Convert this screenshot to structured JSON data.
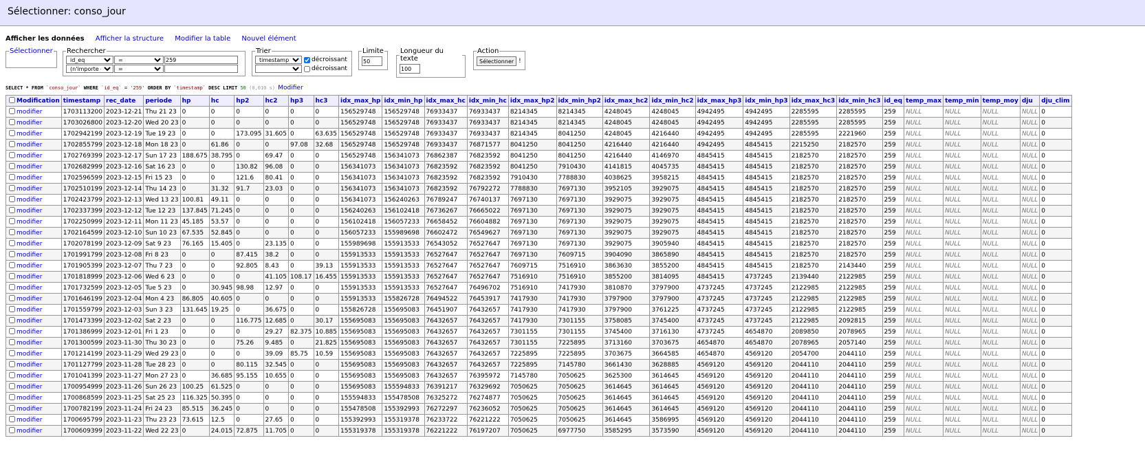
{
  "title": "Sélectionner: conso_jour",
  "nav": [
    "Afficher les données",
    "Afficher la structure",
    "Modifier la table",
    "Nouvel élément"
  ],
  "forms": {
    "select_legend": "Sélectionner",
    "search_legend": "Rechercher",
    "search_rows": [
      {
        "column": "id_eq",
        "op": "=",
        "value": "259"
      },
      {
        "column": "(n'importe où)",
        "op": "=",
        "value": ""
      }
    ],
    "sort_legend": "Trier",
    "sort_rows": [
      {
        "column": "timestamp",
        "desc_checked": true,
        "label": "décroissant"
      },
      {
        "column": "",
        "desc_checked": false,
        "label": "décroissant"
      }
    ],
    "limit_legend": "Limite",
    "limit_value": "50",
    "textlen_legend": "Longueur du texte",
    "textlen_value": "100",
    "action_legend": "Action",
    "action_button": "Sélectionner",
    "action_suffix": "!"
  },
  "sql": {
    "parts": [
      "SELECT * FROM ",
      "`conso_jour`",
      " WHERE ",
      "`id_eq`",
      " = ",
      "'259'",
      " ORDER BY ",
      "`timestamp`",
      " DESC LIMIT ",
      "50",
      " (0,010 s) "
    ],
    "link": "Modifier"
  },
  "table": {
    "modification_label": "Modification",
    "row_link": "modifier",
    "columns": [
      "timestamp",
      "rec_date",
      "periode",
      "hp",
      "hc",
      "hp2",
      "hc2",
      "hp3",
      "hc3",
      "idx_max_hp",
      "idx_min_hp",
      "idx_max_hc",
      "idx_min_hc",
      "idx_max_hp2",
      "idx_min_hp2",
      "idx_max_hc2",
      "idx_min_hc2",
      "idx_max_hp3",
      "idx_min_hp3",
      "idx_max_hc3",
      "idx_min_hc3",
      "id_eq",
      "temp_max",
      "temp_min",
      "temp_moy",
      "dju",
      "dju_clim"
    ],
    "rows": [
      [
        "1703113200",
        "2023-12-21",
        "Thu 21 23",
        "0",
        "0",
        "0",
        "0",
        "0",
        "0",
        "156529748",
        "156529748",
        "76933437",
        "76933437",
        "8214345",
        "8214345",
        "4248045",
        "4248045",
        "4942495",
        "4942495",
        "2285595",
        "2285595",
        "259",
        "NULL",
        "NULL",
        "NULL",
        "NULL",
        "0"
      ],
      [
        "1703026800",
        "2023-12-20",
        "Wed 20 23",
        "0",
        "0",
        "0",
        "0",
        "0",
        "0",
        "156529748",
        "156529748",
        "76933437",
        "76933437",
        "8214345",
        "8214345",
        "4248045",
        "4248045",
        "4942495",
        "4942495",
        "2285595",
        "2285595",
        "259",
        "NULL",
        "NULL",
        "NULL",
        "NULL",
        "0"
      ],
      [
        "1702942199",
        "2023-12-19",
        "Tue 19 23",
        "0",
        "0",
        "173.095",
        "31.605",
        "0",
        "63.635",
        "156529748",
        "156529748",
        "76933437",
        "76933437",
        "8214345",
        "8041250",
        "4248045",
        "4216440",
        "4942495",
        "4942495",
        "2285595",
        "2221960",
        "259",
        "NULL",
        "NULL",
        "NULL",
        "NULL",
        "0"
      ],
      [
        "1702855799",
        "2023-12-18",
        "Mon 18 23",
        "0",
        "61.86",
        "0",
        "0",
        "97.08",
        "32.68",
        "156529748",
        "156529748",
        "76933437",
        "76871577",
        "8041250",
        "8041250",
        "4216440",
        "4216440",
        "4942495",
        "4845415",
        "2215250",
        "2182570",
        "259",
        "NULL",
        "NULL",
        "NULL",
        "NULL",
        "0"
      ],
      [
        "1702769399",
        "2023-12-17",
        "Sun 17 23",
        "188.675",
        "38.795",
        "0",
        "69.47",
        "0",
        "0",
        "156529748",
        "156341073",
        "76862387",
        "76823592",
        "8041250",
        "8041250",
        "4216440",
        "4146970",
        "4845415",
        "4845415",
        "2182570",
        "2182570",
        "259",
        "NULL",
        "NULL",
        "NULL",
        "NULL",
        "0"
      ],
      [
        "1702682999",
        "2023-12-16",
        "Sat 16 23",
        "0",
        "0",
        "130.82",
        "96.08",
        "0",
        "0",
        "156341073",
        "156341073",
        "76823592",
        "76823592",
        "8041250",
        "7910430",
        "4141815",
        "4045735",
        "4845415",
        "4845415",
        "2182570",
        "2182570",
        "259",
        "NULL",
        "NULL",
        "NULL",
        "NULL",
        "0"
      ],
      [
        "1702596599",
        "2023-12-15",
        "Fri 15 23",
        "0",
        "0",
        "121.6",
        "80.41",
        "0",
        "0",
        "156341073",
        "156341073",
        "76823592",
        "76823592",
        "7910430",
        "7788830",
        "4038625",
        "3958215",
        "4845415",
        "4845415",
        "2182570",
        "2182570",
        "259",
        "NULL",
        "NULL",
        "NULL",
        "NULL",
        "0"
      ],
      [
        "1702510199",
        "2023-12-14",
        "Thu 14 23",
        "0",
        "31.32",
        "91.7",
        "23.03",
        "0",
        "0",
        "156341073",
        "156341073",
        "76823592",
        "76792272",
        "7788830",
        "7697130",
        "3952105",
        "3929075",
        "4845415",
        "4845415",
        "2182570",
        "2182570",
        "259",
        "NULL",
        "NULL",
        "NULL",
        "NULL",
        "0"
      ],
      [
        "1702423799",
        "2023-12-13",
        "Wed 13 23",
        "100.81",
        "49.11",
        "0",
        "0",
        "0",
        "0",
        "156341073",
        "156240263",
        "76789247",
        "76740137",
        "7697130",
        "7697130",
        "3929075",
        "3929075",
        "4845415",
        "4845415",
        "2182570",
        "2182570",
        "259",
        "NULL",
        "NULL",
        "NULL",
        "NULL",
        "0"
      ],
      [
        "1702337399",
        "2023-12-12",
        "Tue 12 23",
        "137.845",
        "71.245",
        "0",
        "0",
        "0",
        "0",
        "156240263",
        "156102418",
        "76736267",
        "76665022",
        "7697130",
        "7697130",
        "3929075",
        "3929075",
        "4845415",
        "4845415",
        "2182570",
        "2182570",
        "259",
        "NULL",
        "NULL",
        "NULL",
        "NULL",
        "0"
      ],
      [
        "1702250999",
        "2023-12-11",
        "Mon 11 23",
        "45.185",
        "53.57",
        "0",
        "0",
        "0",
        "0",
        "156102418",
        "156057233",
        "76658452",
        "76604882",
        "7697130",
        "7697130",
        "3929075",
        "3929075",
        "4845415",
        "4845415",
        "2182570",
        "2182570",
        "259",
        "NULL",
        "NULL",
        "NULL",
        "NULL",
        "0"
      ],
      [
        "1702164599",
        "2023-12-10",
        "Sun 10 23",
        "67.535",
        "52.845",
        "0",
        "0",
        "0",
        "0",
        "156057233",
        "155989698",
        "76602472",
        "76549627",
        "7697130",
        "7697130",
        "3929075",
        "3929075",
        "4845415",
        "4845415",
        "2182570",
        "2182570",
        "259",
        "NULL",
        "NULL",
        "NULL",
        "NULL",
        "0"
      ],
      [
        "1702078199",
        "2023-12-09",
        "Sat 9 23",
        "76.165",
        "15.405",
        "0",
        "23.135",
        "0",
        "0",
        "155989698",
        "155913533",
        "76543052",
        "76527647",
        "7697130",
        "7697130",
        "3929075",
        "3905940",
        "4845415",
        "4845415",
        "2182570",
        "2182570",
        "259",
        "NULL",
        "NULL",
        "NULL",
        "NULL",
        "0"
      ],
      [
        "1701991799",
        "2023-12-08",
        "Fri 8 23",
        "0",
        "0",
        "87.415",
        "38.2",
        "0",
        "0",
        "155913533",
        "155913533",
        "76527647",
        "76527647",
        "7697130",
        "7609715",
        "3904090",
        "3865890",
        "4845415",
        "4845415",
        "2182570",
        "2182570",
        "259",
        "NULL",
        "NULL",
        "NULL",
        "NULL",
        "0"
      ],
      [
        "1701905399",
        "2023-12-07",
        "Thu 7 23",
        "0",
        "0",
        "92.805",
        "8.43",
        "0",
        "39.13",
        "155913533",
        "155913533",
        "76527647",
        "76527647",
        "7609715",
        "7516910",
        "3863630",
        "3855200",
        "4845415",
        "4845415",
        "2182570",
        "2143440",
        "259",
        "NULL",
        "NULL",
        "NULL",
        "NULL",
        "0"
      ],
      [
        "1701818999",
        "2023-12-06",
        "Wed 6 23",
        "0",
        "0",
        "0",
        "41.105",
        "108.17",
        "16.455",
        "155913533",
        "155913533",
        "76527647",
        "76527647",
        "7516910",
        "7516910",
        "3855200",
        "3814095",
        "4845415",
        "4737245",
        "2139440",
        "2122985",
        "259",
        "NULL",
        "NULL",
        "NULL",
        "NULL",
        "0"
      ],
      [
        "1701732599",
        "2023-12-05",
        "Tue 5 23",
        "0",
        "30.945",
        "98.98",
        "12.97",
        "0",
        "0",
        "155913533",
        "155913533",
        "76527647",
        "76496702",
        "7516910",
        "7417930",
        "3810870",
        "3797900",
        "4737245",
        "4737245",
        "2122985",
        "2122985",
        "259",
        "NULL",
        "NULL",
        "NULL",
        "NULL",
        "0"
      ],
      [
        "1701646199",
        "2023-12-04",
        "Mon 4 23",
        "86.805",
        "40.605",
        "0",
        "0",
        "0",
        "0",
        "155913533",
        "155826728",
        "76494522",
        "76453917",
        "7417930",
        "7417930",
        "3797900",
        "3797900",
        "4737245",
        "4737245",
        "2122985",
        "2122985",
        "259",
        "NULL",
        "NULL",
        "NULL",
        "NULL",
        "0"
      ],
      [
        "1701559799",
        "2023-12-03",
        "Sun 3 23",
        "131.645",
        "19.25",
        "0",
        "36.675",
        "0",
        "0",
        "155826728",
        "155695083",
        "76451907",
        "76432657",
        "7417930",
        "7417930",
        "3797900",
        "3761225",
        "4737245",
        "4737245",
        "2122985",
        "2122985",
        "259",
        "NULL",
        "NULL",
        "NULL",
        "NULL",
        "0"
      ],
      [
        "1701473399",
        "2023-12-02",
        "Sat 2 23",
        "0",
        "0",
        "116.775",
        "12.685",
        "0",
        "30.17",
        "155695083",
        "155695083",
        "76432657",
        "76432657",
        "7417930",
        "7301155",
        "3758085",
        "3745400",
        "4737245",
        "4737245",
        "2122985",
        "2092815",
        "259",
        "NULL",
        "NULL",
        "NULL",
        "NULL",
        "0"
      ],
      [
        "1701386999",
        "2023-12-01",
        "Fri 1 23",
        "0",
        "0",
        "0",
        "29.27",
        "82.375",
        "10.885",
        "155695083",
        "155695083",
        "76432657",
        "76432657",
        "7301155",
        "7301155",
        "3745400",
        "3716130",
        "4737245",
        "4654870",
        "2089850",
        "2078965",
        "259",
        "NULL",
        "NULL",
        "NULL",
        "NULL",
        "0"
      ],
      [
        "1701300599",
        "2023-11-30",
        "Thu 30 23",
        "0",
        "0",
        "75.26",
        "9.485",
        "0",
        "21.825",
        "155695083",
        "155695083",
        "76432657",
        "76432657",
        "7301155",
        "7225895",
        "3713160",
        "3703675",
        "4654870",
        "4654870",
        "2078965",
        "2057140",
        "259",
        "NULL",
        "NULL",
        "NULL",
        "NULL",
        "0"
      ],
      [
        "1701214199",
        "2023-11-29",
        "Wed 29 23",
        "0",
        "0",
        "0",
        "39.09",
        "85.75",
        "10.59",
        "155695083",
        "155695083",
        "76432657",
        "76432657",
        "7225895",
        "7225895",
        "3703675",
        "3664585",
        "4654870",
        "4569120",
        "2054700",
        "2044110",
        "259",
        "NULL",
        "NULL",
        "NULL",
        "NULL",
        "0"
      ],
      [
        "1701127799",
        "2023-11-28",
        "Tue 28 23",
        "0",
        "0",
        "80.115",
        "32.545",
        "0",
        "0",
        "155695083",
        "155695083",
        "76432657",
        "76432657",
        "7225895",
        "7145780",
        "3661430",
        "3628885",
        "4569120",
        "4569120",
        "2044110",
        "2044110",
        "259",
        "NULL",
        "NULL",
        "NULL",
        "NULL",
        "0"
      ],
      [
        "1701041399",
        "2023-11-27",
        "Mon 27 23",
        "0",
        "36.685",
        "95.155",
        "10.655",
        "0",
        "0",
        "155695083",
        "155695083",
        "76432657",
        "76395972",
        "7145780",
        "7050625",
        "3625300",
        "3614645",
        "4569120",
        "4569120",
        "2044110",
        "2044110",
        "259",
        "NULL",
        "NULL",
        "NULL",
        "NULL",
        "0"
      ],
      [
        "1700954999",
        "2023-11-26",
        "Sun 26 23",
        "100.25",
        "61.525",
        "0",
        "0",
        "0",
        "0",
        "155695083",
        "155594833",
        "76391217",
        "76329692",
        "7050625",
        "7050625",
        "3614645",
        "3614645",
        "4569120",
        "4569120",
        "2044110",
        "2044110",
        "259",
        "NULL",
        "NULL",
        "NULL",
        "NULL",
        "0"
      ],
      [
        "1700868599",
        "2023-11-25",
        "Sat 25 23",
        "116.325",
        "50.395",
        "0",
        "0",
        "0",
        "0",
        "155594833",
        "155478508",
        "76325272",
        "76274877",
        "7050625",
        "7050625",
        "3614645",
        "3614645",
        "4569120",
        "4569120",
        "2044110",
        "2044110",
        "259",
        "NULL",
        "NULL",
        "NULL",
        "NULL",
        "0"
      ],
      [
        "1700782199",
        "2023-11-24",
        "Fri 24 23",
        "85.515",
        "36.245",
        "0",
        "0",
        "0",
        "0",
        "155478508",
        "155392993",
        "76272297",
        "76236052",
        "7050625",
        "7050625",
        "3614645",
        "3614645",
        "4569120",
        "4569120",
        "2044110",
        "2044110",
        "259",
        "NULL",
        "NULL",
        "NULL",
        "NULL",
        "0"
      ],
      [
        "1700695799",
        "2023-11-23",
        "Thu 23 23",
        "73.615",
        "12.5",
        "0",
        "27.65",
        "0",
        "0",
        "155392993",
        "155319378",
        "76233722",
        "76221222",
        "7050625",
        "7050625",
        "3614645",
        "3586995",
        "4569120",
        "4569120",
        "2044110",
        "2044110",
        "259",
        "NULL",
        "NULL",
        "NULL",
        "NULL",
        "0"
      ],
      [
        "1700609399",
        "2023-11-22",
        "Wed 22 23",
        "0",
        "24.015",
        "72.875",
        "11.705",
        "0",
        "0",
        "155319378",
        "155319378",
        "76221222",
        "76197207",
        "7050625",
        "6977750",
        "3585295",
        "3573590",
        "4569120",
        "4569120",
        "2044110",
        "2044110",
        "259",
        "NULL",
        "NULL",
        "NULL",
        "NULL",
        "0"
      ]
    ]
  }
}
